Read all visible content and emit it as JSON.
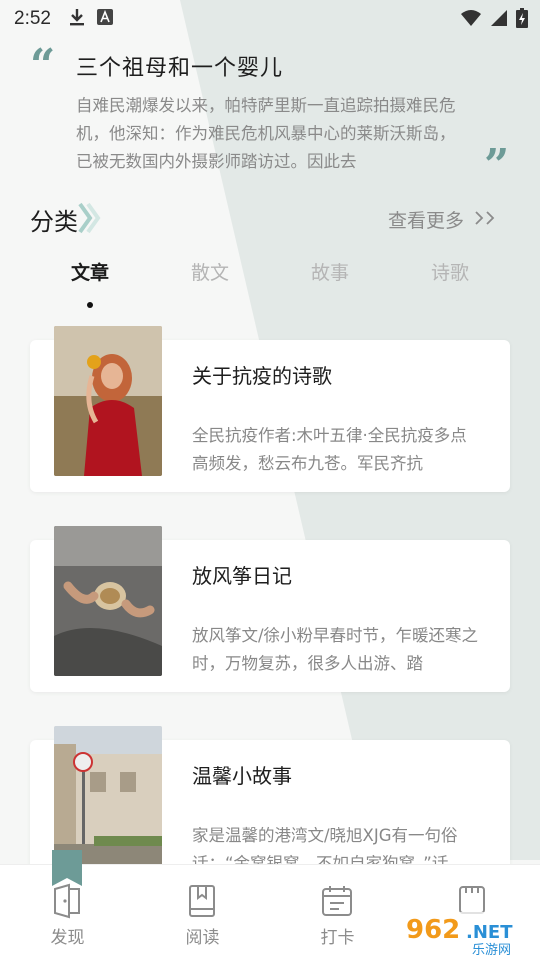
{
  "status_bar": {
    "time": "2:52",
    "icons": [
      "download-icon",
      "a-icon",
      "wifi-icon",
      "signal-icon",
      "battery-icon"
    ]
  },
  "quote": {
    "title": "三个祖母和一个婴儿",
    "body": "自难民潮爆发以来，帕特萨里斯一直追踪拍摄难民危机，他深知：作为难民危机风暴中心的莱斯沃斯岛，已被无数国内外摄影师踏访过。因此去",
    "accent_color": "#6d9b97"
  },
  "category": {
    "title": "分类",
    "more_label": "查看更多",
    "more_arrow": ">>"
  },
  "tabs": [
    {
      "label": "文章",
      "active": true
    },
    {
      "label": "散文",
      "active": false
    },
    {
      "label": "故事",
      "active": false
    },
    {
      "label": "诗歌",
      "active": false
    }
  ],
  "articles": [
    {
      "title": "关于抗疫的诗歌",
      "desc": "全民抗疫作者:木叶五律·全民抗疫多点高频发，愁云布九苍。军民齐抗",
      "thumb": "woman-red-dress-photo"
    },
    {
      "title": "放风筝日记",
      "desc": "放风筝文/徐小粉早春时节，乍暖还寒之时，万物复苏，很多人出游、踏",
      "thumb": "hands-holding-cup-photo"
    },
    {
      "title": "温馨小故事",
      "desc": "家是温馨的港湾文/晓旭XJG有一句俗话：“金窝银窝，不如自家狗窝。”话",
      "thumb": "street-building-photo"
    }
  ],
  "bottom_nav": [
    {
      "label": "发现",
      "icon": "discover-icon"
    },
    {
      "label": "阅读",
      "icon": "book-icon"
    },
    {
      "label": "打卡",
      "icon": "checkin-icon"
    },
    {
      "label": "",
      "icon": "profile-icon"
    }
  ],
  "watermark": {
    "brand": "962.NET",
    "sub": "乐游网"
  }
}
